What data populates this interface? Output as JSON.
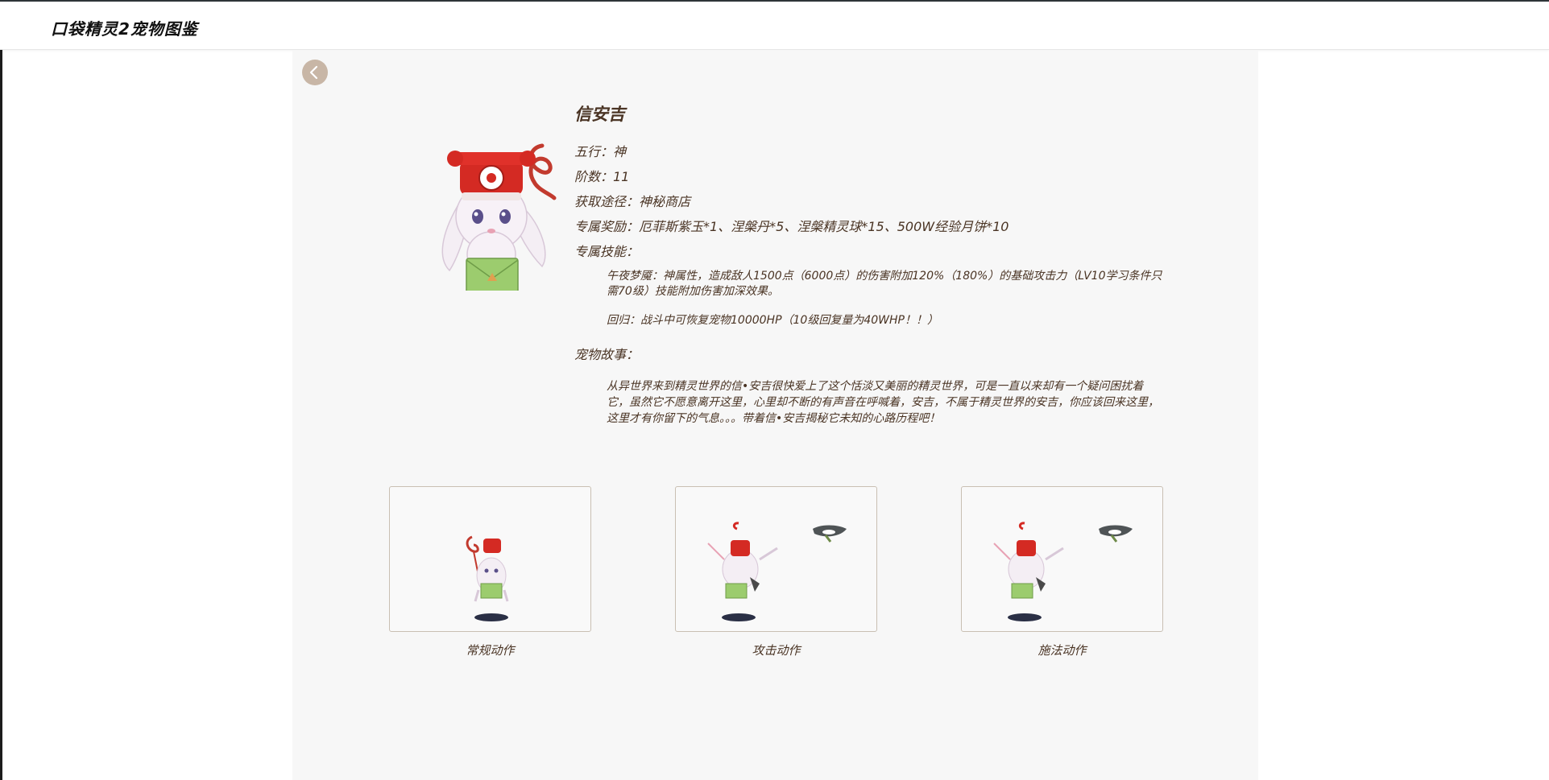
{
  "site": {
    "title": "口袋精灵2宠物图鉴"
  },
  "pet": {
    "name": "信安吉",
    "element_label": "五行：神",
    "stage_label": "阶数：11",
    "source_label": "获取途径：神秘商店",
    "reward_label": "专属奖励：厄菲斯紫玉*1、涅槃丹*5、涅槃精灵球*15、500W经验月饼*10",
    "skills_heading": "专属技能：",
    "skills": [
      {
        "text": "午夜梦魇：神属性，造成敌人1500点（6000点）的伤害附加120%（180%）的基础攻击力（LV10学习条件只需70级）技能附加伤害加深效果。"
      },
      {
        "text": "回归：战斗中可恢复宠物10000HP（10级回复量为40WHP！！）"
      }
    ],
    "story_heading": "宠物故事：",
    "story": "从异世界来到精灵世界的信•安吉很快爱上了这个恬淡又美丽的精灵世界，可是一直以来却有一个疑问困扰着它，虽然它不愿意离开这里，心里却不断的有声音在呼喊着，安吉，不属于精灵世界的安吉，你应该回来这里，这里才有你留下的气息。。。带着信•安吉揭秘它未知的心路历程吧！"
  },
  "animations": [
    {
      "label": "常规动作"
    },
    {
      "label": "攻击动作"
    },
    {
      "label": "施法动作"
    }
  ],
  "colors": {
    "text": "#4a3424",
    "panel": "#f7f7f7",
    "back_button": "#c8b6a6",
    "card_border": "#c9bfb3",
    "phone_red": "#d42a23",
    "envelope_green": "#9ccc6e"
  },
  "icons": {
    "back": "chevron-left-icon"
  }
}
